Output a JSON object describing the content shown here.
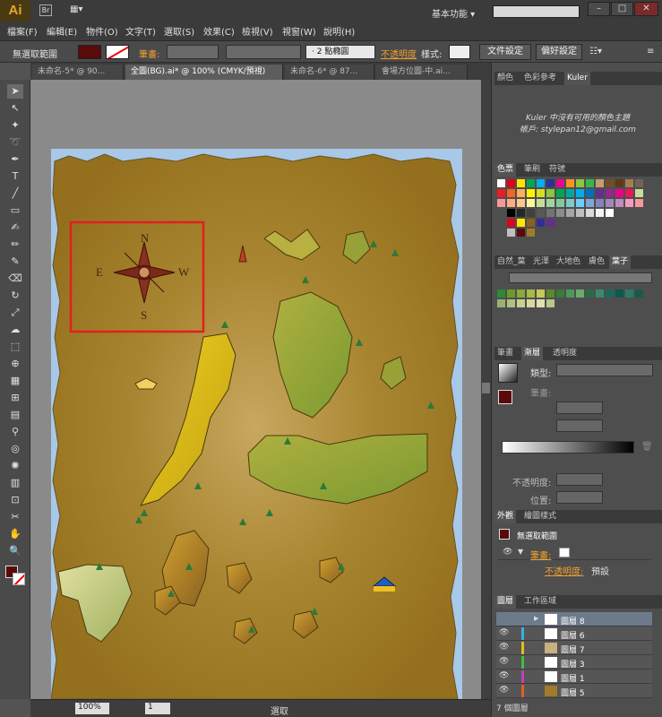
{
  "app": {
    "logo": "Ai",
    "workspace": "基本功能",
    "search_placeholder": ""
  },
  "menu": [
    "檔案(F)",
    "編輯(E)",
    "物件(O)",
    "文字(T)",
    "選取(S)",
    "效果(C)",
    "檢視(V)",
    "視窗(W)",
    "說明(H)"
  ],
  "control": {
    "selection": "無選取範圍",
    "stroke_label": "筆畫:",
    "stroke_profile": "2 點橢圓",
    "opacity_label": "不透明度",
    "style_label": "樣式:",
    "doc_setup": "文件設定",
    "prefs": "偏好設定"
  },
  "tabs": [
    "未命名-5* @ 90...",
    "全圖(BG).ai* @ 100% (CMYK/預視)",
    "未命名-6* @ 87...",
    "會場方位圖-中.ai..."
  ],
  "toolbar": {
    "icons": [
      "selection-tool",
      "direct-selection-tool",
      "magic-wand-tool",
      "lasso-tool",
      "pen-tool",
      "type-tool",
      "line-tool",
      "rectangle-tool",
      "paintbrush-tool",
      "pencil-tool",
      "blob-brush-tool",
      "eraser-tool",
      "rotate-tool",
      "scale-tool",
      "warp-tool",
      "free-transform-tool",
      "shape-builder-tool",
      "perspective-grid-tool",
      "mesh-tool",
      "gradient-tool",
      "eyedropper-tool",
      "blend-tool",
      "symbol-sprayer-tool",
      "column-graph-tool",
      "artboard-tool",
      "slice-tool",
      "hand-tool",
      "zoom-tool"
    ]
  },
  "compass": {
    "n": "N",
    "s": "S",
    "e": "E",
    "w": "W"
  },
  "status": {
    "zoom": "100%",
    "page": "1",
    "mode": "選取"
  },
  "panels": {
    "color_tabs": [
      "顏色",
      "色彩參考",
      "Kuler"
    ],
    "kuler_msg1": "Kuler 中沒有可用的顏色主題",
    "kuler_msg2": "帳戶: stylepan12@gmail.com",
    "swatch_tabs": [
      "色票",
      "筆刷",
      "符號"
    ],
    "lib_tabs": [
      "自然_葉",
      "光澤",
      "大地色",
      "膚色",
      "葉子"
    ],
    "stroke_tabs": [
      "筆畫",
      "漸層",
      "透明度"
    ],
    "gradient": {
      "type_label": "類型:",
      "stroke_label": "筆畫:",
      "opacity_label": "不透明度:",
      "position_label": "位置:"
    },
    "appearance_tabs": [
      "外觀",
      "繪圖樣式"
    ],
    "appearance": {
      "title": "無選取範圍",
      "stroke": "筆畫:",
      "opacity": "不透明度:",
      "opacity_value": "預設"
    },
    "layers_tabs": [
      "圖層",
      "工作區域"
    ],
    "layers": [
      "圖層 8",
      "圖層 6",
      "圖層 7",
      "圖層 3",
      "圖層 1",
      "圖層 5"
    ],
    "layers_count": "7 個圖層"
  },
  "colors": {
    "fill": "#5a0a0a",
    "parchment": "#a07c28",
    "land_yellow": "#e0c020",
    "land_green": "#9aaa3a",
    "selection_box": "#e02020"
  }
}
